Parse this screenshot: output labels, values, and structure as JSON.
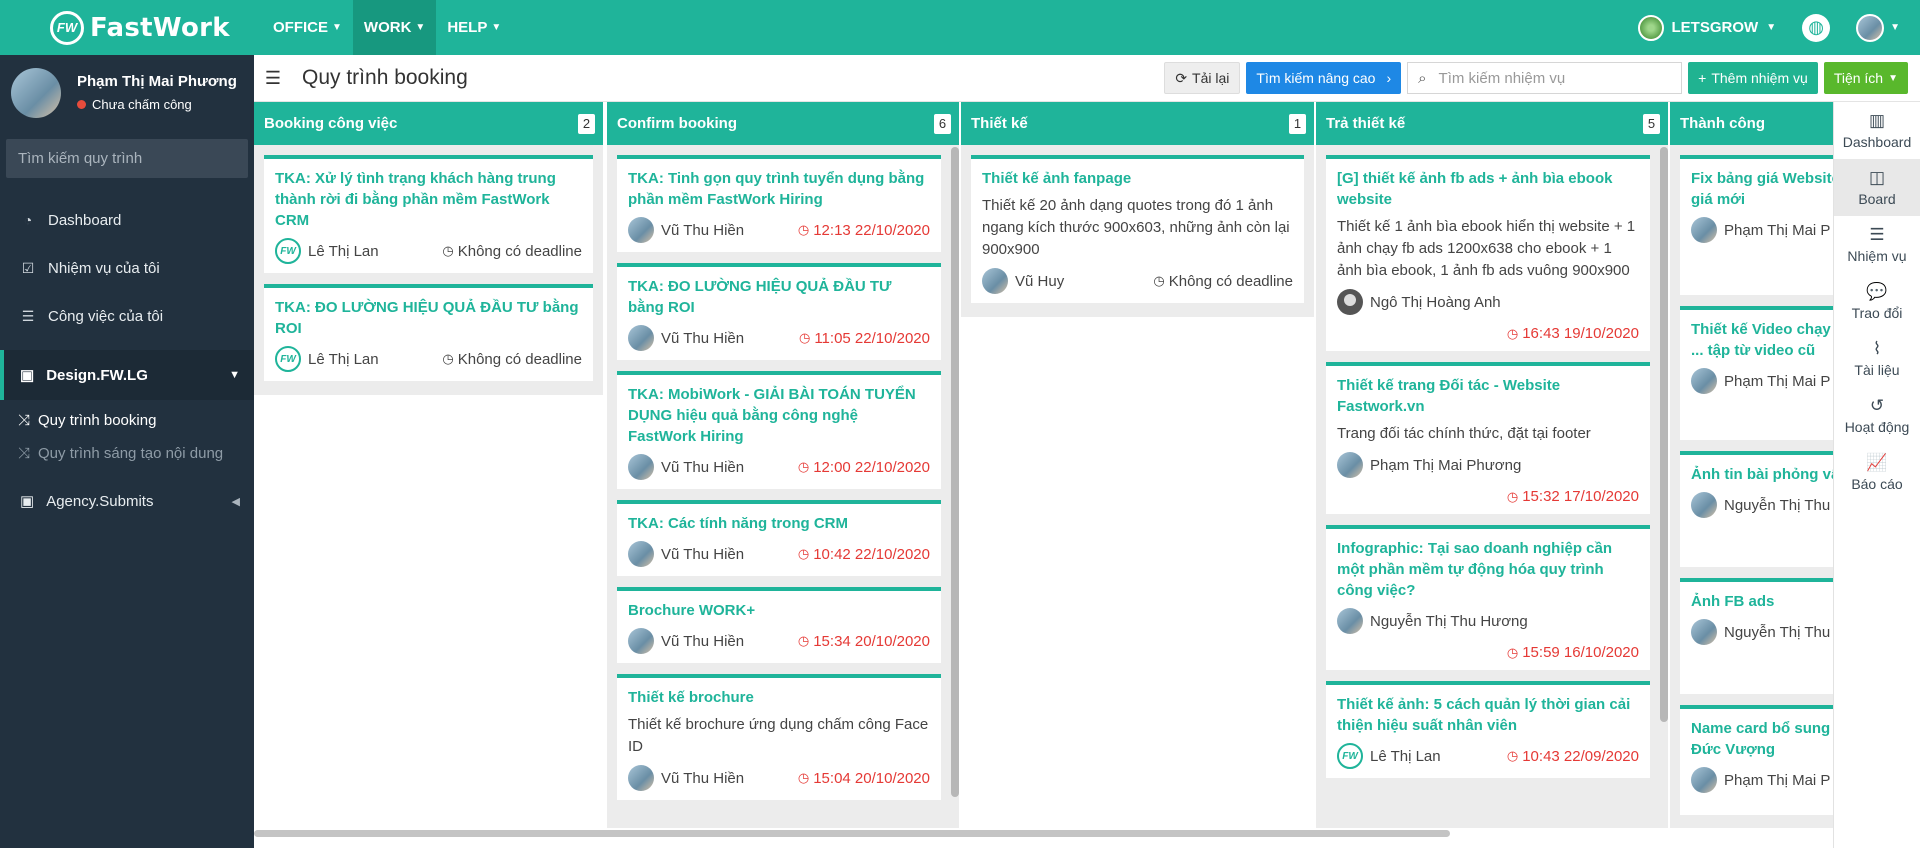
{
  "brand": {
    "badge": "FW",
    "name": "FastWork"
  },
  "topnav": [
    {
      "label": "OFFICE"
    },
    {
      "label": "WORK"
    },
    {
      "label": "HELP"
    }
  ],
  "org": {
    "name": "LETSGROW"
  },
  "sidebar": {
    "user_name": "Phạm Thị Mai Phương",
    "user_status": "Chưa chấm công",
    "search_placeholder": "Tìm kiếm quy trình",
    "items": [
      {
        "label": "Dashboard",
        "icon": "dashboard-icon"
      },
      {
        "label": "Nhiệm vụ của tôi",
        "icon": "checkbox-icon"
      },
      {
        "label": "Công việc của tôi",
        "icon": "list-icon"
      }
    ],
    "group": {
      "label": "Design.FW.LG",
      "icon": "org-icon"
    },
    "subitems": [
      {
        "label": "Quy trình booking"
      },
      {
        "label": "Quy trình sáng tạo nội dung"
      }
    ],
    "group2": {
      "label": "Agency.Submits"
    }
  },
  "header": {
    "title": "Quy trình booking",
    "reload": "Tải lại",
    "advanced_search": "Tìm kiếm nâng cao",
    "search_placeholder": "Tìm kiếm nhiệm vụ",
    "add_task": "Thêm nhiệm vụ",
    "utilities": "Tiện ích"
  },
  "columns": [
    {
      "title": "Booking công việc",
      "count": "2",
      "cards": [
        {
          "title": "TKA: Xử lý tình trạng khách hàng trung thành rời đi bằng phần mềm FastWork CRM",
          "desc": "",
          "assignee": "Lê Thị Lan",
          "deadline": "Không có deadline",
          "avatar": "fw"
        },
        {
          "title": "TKA: ĐO LƯỜNG HIỆU QUẢ ĐẦU TƯ bằng ROI",
          "desc": "",
          "assignee": "Lê Thị Lan",
          "deadline": "Không có deadline",
          "avatar": "fw"
        }
      ]
    },
    {
      "title": "Confirm booking",
      "count": "6",
      "cards": [
        {
          "title": "TKA: Tinh gọn quy trình tuyển dụng bằng phần mềm FastWork Hiring",
          "desc": "",
          "assignee": "Vũ Thu Hiền",
          "deadline": "12:13 22/10/2020",
          "avatar": "photo"
        },
        {
          "title": "TKA: ĐO LƯỜNG HIỆU QUẢ ĐẦU TƯ bằng ROI",
          "desc": "",
          "assignee": "Vũ Thu Hiền",
          "deadline": "11:05 22/10/2020",
          "avatar": "photo"
        },
        {
          "title": "TKA: MobiWork - GIẢI BÀI TOÁN TUYỂN DỤNG hiệu quả bằng công nghệ FastWork Hiring",
          "desc": "",
          "assignee": "Vũ Thu Hiền",
          "deadline": "12:00 22/10/2020",
          "avatar": "photo"
        },
        {
          "title": "TKA: Các tính năng trong CRM",
          "desc": "",
          "assignee": "Vũ Thu Hiền",
          "deadline": "10:42 22/10/2020",
          "avatar": "photo"
        },
        {
          "title": "Brochure WORK+",
          "desc": "",
          "assignee": "Vũ Thu Hiền",
          "deadline": "15:34 20/10/2020",
          "avatar": "photo"
        },
        {
          "title": "Thiết kế brochure",
          "desc": "Thiết kế brochure ứng dụng chấm công Face ID",
          "assignee": "Vũ Thu Hiền",
          "deadline": "15:04 20/10/2020",
          "avatar": "photo"
        }
      ]
    },
    {
      "title": "Thiết kế",
      "count": "1",
      "cards": [
        {
          "title": "Thiết kế ảnh fanpage",
          "desc": "Thiết kế 20 ảnh dạng quotes trong đó 1 ảnh ngang kích thước 900x603, những ảnh còn lại 900x900",
          "assignee": "Vũ Huy",
          "deadline": "Không có deadline",
          "avatar": "photo"
        }
      ]
    },
    {
      "title": "Trả thiết kế",
      "count": "5",
      "cards": [
        {
          "title": "[G] thiết kế ảnh fb ads + ảnh bìa ebook website",
          "desc": "Thiết kế 1 ảnh bìa ebook hiển thị website + 1 ảnh chạy fb ads 1200x638 cho ebook + 1 ảnh bìa ebook, 1 ảnh fb ads vuông 900x900",
          "assignee": "Ngô Thị Hoàng Anh",
          "deadline": "16:43 19/10/2020",
          "avatar": "gray"
        },
        {
          "title": "Thiết kế trang Đối tác - Website Fastwork.vn",
          "desc": "Trang đối tác chính thức, đặt tại footer",
          "assignee": "Phạm Thị Mai Phương",
          "deadline": "15:32 17/10/2020",
          "avatar": "photo"
        },
        {
          "title": "Infographic: Tại sao doanh nghiệp cần một phần mềm tự động hóa quy trình công việc?",
          "desc": "",
          "assignee": "Nguyễn Thị Thu Hương",
          "deadline": "15:59 16/10/2020",
          "avatar": "photo"
        },
        {
          "title": "Thiết kế ảnh: 5 cách quản lý thời gian cải thiện hiệu suất nhân viên",
          "desc": "",
          "assignee": "Lê Thị Lan",
          "deadline": "10:43 22/09/2020",
          "avatar": "fw"
        }
      ]
    },
    {
      "title": "Thành công",
      "count": "",
      "cards": [
        {
          "title": "Fix bảng giá Website giá mới",
          "desc": "",
          "assignee": "Phạm Thị Mai P",
          "deadline": "",
          "avatar": "photo"
        },
        {
          "title": "Thiết kế Video chạy ... tập từ video cũ",
          "desc": "",
          "assignee": "Phạm Thị Mai P",
          "deadline": "",
          "avatar": "photo"
        },
        {
          "title": "Ảnh tin bài phỏng vấ",
          "desc": "",
          "assignee": "Nguyễn Thị Thu",
          "deadline": "",
          "avatar": "photo"
        },
        {
          "title": "Ảnh FB ads",
          "desc": "",
          "assignee": "Nguyễn Thị Thu",
          "deadline": "",
          "avatar": "photo"
        },
        {
          "title": "Name card bổ sung - Đức Vượng",
          "desc": "",
          "assignee": "Phạm Thị Mai P",
          "deadline": "",
          "avatar": "photo"
        }
      ]
    }
  ],
  "rail": [
    {
      "label": "Dashboard",
      "icon": "bar-chart-icon"
    },
    {
      "label": "Board",
      "icon": "columns-icon"
    },
    {
      "label": "Nhiệm vụ",
      "icon": "list-icon"
    },
    {
      "label": "Trao đổi",
      "icon": "chat-icon"
    },
    {
      "label": "Tài liệu",
      "icon": "paperclip-icon"
    },
    {
      "label": "Hoạt động",
      "icon": "history-icon"
    },
    {
      "label": "Báo cáo",
      "icon": "line-chart-icon"
    }
  ],
  "colors": {
    "primary": "#1fb49a",
    "sidebar": "#22313f",
    "deadline": "#e53935",
    "blue": "#1e88e5",
    "lime": "#59b82c"
  }
}
